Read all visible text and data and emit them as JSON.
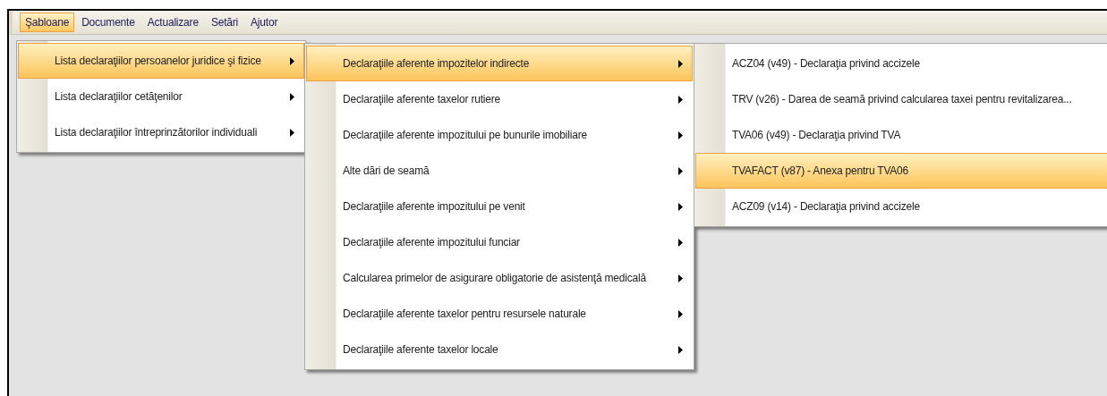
{
  "menu_bar": [
    {
      "label": "Şabloane",
      "selected": true
    },
    {
      "label": "Documente",
      "selected": false
    },
    {
      "label": "Actualizare",
      "selected": false
    },
    {
      "label": "Setări",
      "selected": false
    },
    {
      "label": "Ajutor",
      "selected": false
    }
  ],
  "menus": [
    {
      "items": [
        {
          "label": "Lista declaraţiilor persoanelor juridice şi fizice",
          "selected": true,
          "has_submenu": true
        },
        {
          "label": "Lista declaraţiilor cetăţenilor",
          "selected": false,
          "has_submenu": true
        },
        {
          "label": "Lista declaraţiilor întreprinzătorilor individuali",
          "selected": false,
          "has_submenu": true
        }
      ]
    },
    {
      "items": [
        {
          "label": "Declaraţiile aferente impozitelor indirecte",
          "selected": true,
          "has_submenu": true
        },
        {
          "label": "Declaraţiile aferente taxelor rutiere",
          "selected": false,
          "has_submenu": true
        },
        {
          "label": "Declaraţiile aferente impozitului pe bunurile imobiliare",
          "selected": false,
          "has_submenu": true
        },
        {
          "label": "Alte dări de seamă",
          "selected": false,
          "has_submenu": true
        },
        {
          "label": "Declaraţiile aferente impozitului pe venit",
          "selected": false,
          "has_submenu": true
        },
        {
          "label": "Declaraţiile aferente impozitului funciar",
          "selected": false,
          "has_submenu": true
        },
        {
          "label": "Calcularea primelor de asigurare obligatorie de asistenţă medicală",
          "selected": false,
          "has_submenu": true
        },
        {
          "label": "Declaraţiile aferente taxelor pentru resursele naturale",
          "selected": false,
          "has_submenu": true
        },
        {
          "label": "Declaraţiile aferente taxelor locale",
          "selected": false,
          "has_submenu": true
        }
      ]
    },
    {
      "items": [
        {
          "label": "ACZ04 (v49) - Declaraţia privind accizele",
          "selected": false,
          "has_submenu": false
        },
        {
          "label": "TRV (v26) - Darea de seamă privind calcularea taxei pentru revitalizarea...",
          "selected": false,
          "has_submenu": false
        },
        {
          "label": "TVA06 (v49) - Declaraţia privind TVA",
          "selected": false,
          "has_submenu": false
        },
        {
          "label": "TVAFACT (v87) - Anexa pentru TVA06",
          "selected": true,
          "has_submenu": false
        },
        {
          "label": "ACZ09 (v14) - Declaraţia privind accizele",
          "selected": false,
          "has_submenu": false
        }
      ]
    }
  ]
}
